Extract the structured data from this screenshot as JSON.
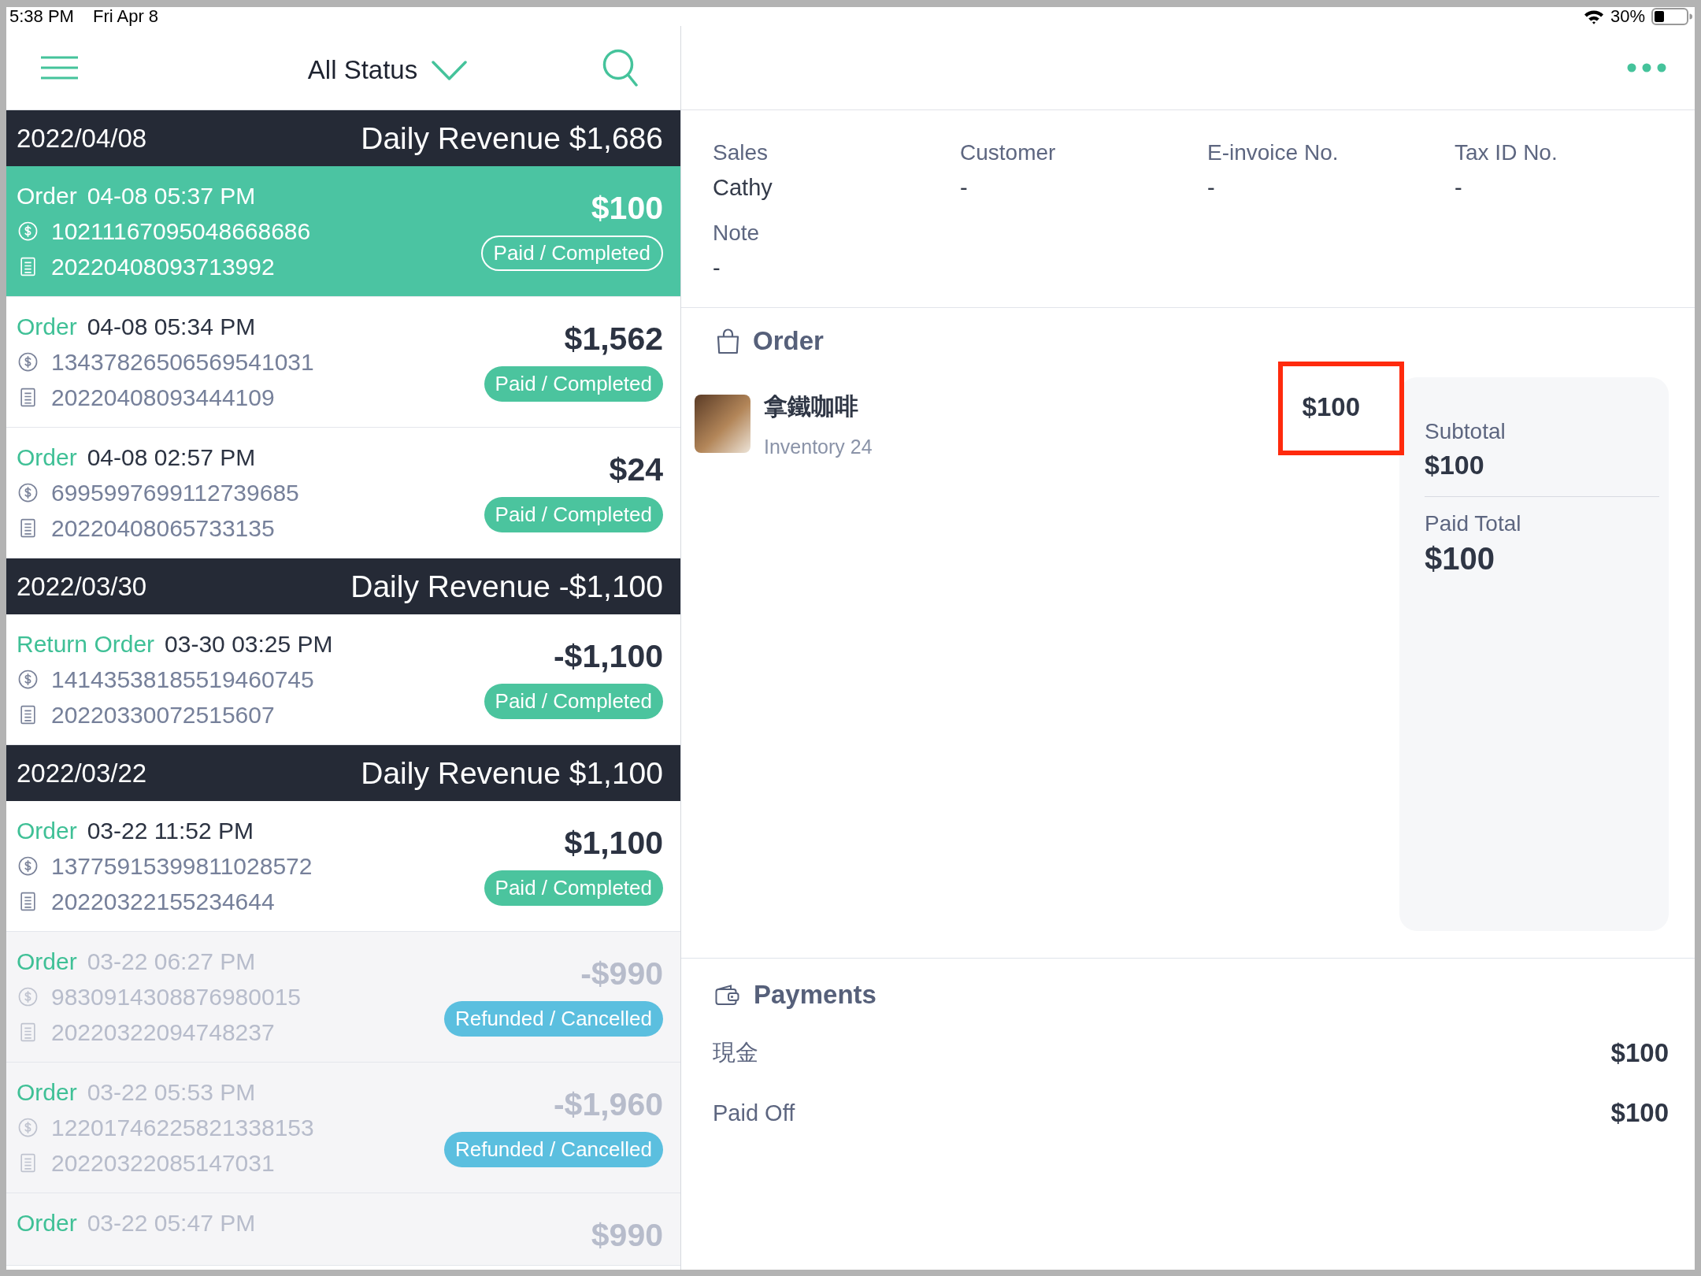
{
  "status_bar": {
    "time": "5:38 PM",
    "date": "Fri Apr 8",
    "battery": "30%"
  },
  "list_header": {
    "filter": "All Status"
  },
  "days": [
    {
      "date": "2022/04/08",
      "revenue": "Daily Revenue $1,686",
      "orders": [
        {
          "type": "Order",
          "time": "04-08 05:37 PM",
          "payment_no": "10211167095048668686",
          "receipt_no": "20220408093713992",
          "amount": "$100",
          "status": "Paid / Completed",
          "kind": "paid",
          "selected": true
        },
        {
          "type": "Order",
          "time": "04-08 05:34 PM",
          "payment_no": "13437826506569541031",
          "receipt_no": "20220408093444109",
          "amount": "$1,562",
          "status": "Paid / Completed",
          "kind": "paid",
          "selected": false
        },
        {
          "type": "Order",
          "time": "04-08 02:57 PM",
          "payment_no": "6995997699112739685",
          "receipt_no": "20220408065733135",
          "amount": "$24",
          "status": "Paid / Completed",
          "kind": "paid",
          "selected": false
        }
      ]
    },
    {
      "date": "2022/03/30",
      "revenue": "Daily Revenue -$1,100",
      "orders": [
        {
          "type": "Return Order",
          "time": "03-30 03:25 PM",
          "payment_no": "14143538185519460745",
          "receipt_no": "20220330072515607",
          "amount": "-$1,100",
          "status": "Paid / Completed",
          "kind": "paid",
          "selected": false
        }
      ]
    },
    {
      "date": "2022/03/22",
      "revenue": "Daily Revenue $1,100",
      "orders": [
        {
          "type": "Order",
          "time": "03-22 11:52 PM",
          "payment_no": "13775915399811028572",
          "receipt_no": "20220322155234644",
          "amount": "$1,100",
          "status": "Paid / Completed",
          "kind": "paid",
          "selected": false
        },
        {
          "type": "Order",
          "time": "03-22 06:27 PM",
          "payment_no": "9830914308876980015",
          "receipt_no": "20220322094748237",
          "amount": "-$990",
          "status": "Refunded / Cancelled",
          "kind": "refunded",
          "selected": false
        },
        {
          "type": "Order",
          "time": "03-22 05:53 PM",
          "payment_no": "12201746225821338153",
          "receipt_no": "20220322085147031",
          "amount": "-$1,960",
          "status": "Refunded / Cancelled",
          "kind": "refunded",
          "selected": false
        },
        {
          "type": "Order",
          "time": "03-22 05:47 PM",
          "amount": "$990",
          "kind": "refunded",
          "selected": false
        }
      ]
    }
  ],
  "details": {
    "fields": [
      {
        "label": "Sales",
        "value": "Cathy"
      },
      {
        "label": "Customer",
        "value": "-"
      },
      {
        "label": "E-invoice No.",
        "value": "-"
      },
      {
        "label": "Tax ID No.",
        "value": "-"
      },
      {
        "label": "Note",
        "value": "-"
      }
    ]
  },
  "order": {
    "title": "Order",
    "items": [
      {
        "name": "拿鐵咖啡",
        "inventory": "Inventory 24",
        "price": "$100",
        "highlighted": true
      }
    ],
    "summary": [
      {
        "label": "Subtotal",
        "value": "$100"
      },
      {
        "label": "Paid Total",
        "value": "$100"
      }
    ]
  },
  "payments": {
    "title": "Payments",
    "rows": [
      {
        "label": "現金",
        "amount": "$100"
      },
      {
        "label": "Paid Off",
        "amount": "$100"
      }
    ]
  }
}
